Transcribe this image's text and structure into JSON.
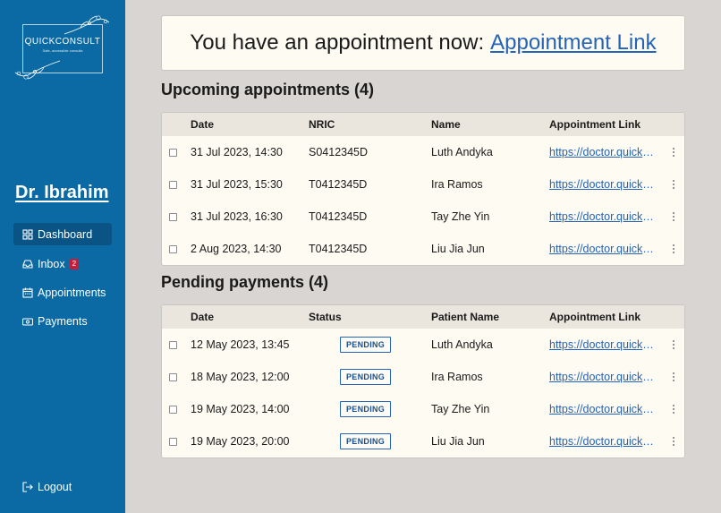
{
  "sidebar": {
    "logo": {
      "brand": "QUICKCONSULT",
      "tagline": "Safe, accessible consults"
    },
    "doctor_name": "Dr. Ibrahim",
    "nav": [
      {
        "label": "Dashboard",
        "icon": "dashboard-icon",
        "active": true
      },
      {
        "label": "Inbox",
        "icon": "inbox-icon",
        "badge": "2"
      },
      {
        "label": "Appointments",
        "icon": "calendar-icon"
      },
      {
        "label": "Payments",
        "icon": "payment-icon"
      }
    ],
    "logout": "Logout"
  },
  "banner": {
    "text": "You have an appointment now:",
    "link": "Appointment Link"
  },
  "upcoming": {
    "title": "Upcoming appointments (4)",
    "headers": [
      "Date",
      "NRIC",
      "Name",
      "Appointment Link"
    ],
    "rows": [
      {
        "date": "31 Jul 2023, 14:30",
        "nric": "S0412345D",
        "name": "Luth Andyka",
        "link": "https://doctor.quickconsult"
      },
      {
        "date": "31 Jul 2023, 15:30",
        "nric": "T0412345D",
        "name": "Ira Ramos",
        "link": "https://doctor.quickconsult"
      },
      {
        "date": "31 Jul 2023, 16:30",
        "nric": "T0412345D",
        "name": "Tay Zhe Yin",
        "link": "https://doctor.quickconsult"
      },
      {
        "date": "2 Aug 2023, 14:30",
        "nric": "T0412345D",
        "name": "Liu Jia Jun",
        "link": "https://doctor.quickconsult"
      }
    ]
  },
  "payments": {
    "title": "Pending payments (4)",
    "headers": [
      "Date",
      "Status",
      "Patient Name",
      "Appointment Link"
    ],
    "rows": [
      {
        "date": "12 May 2023, 13:45",
        "status": "PENDING",
        "name": "Luth Andyka",
        "link": "https://doctor.quickconsult"
      },
      {
        "date": "18 May 2023, 12:00",
        "status": "PENDING",
        "name": "Ira Ramos",
        "link": "https://doctor.quickconsult"
      },
      {
        "date": "19 May 2023, 14:00",
        "status": "PENDING",
        "name": "Tay Zhe Yin",
        "link": "https://doctor.quickconsult"
      },
      {
        "date": "19 May 2023, 20:00",
        "status": "PENDING",
        "name": "Liu Jia Jun",
        "link": "https://doctor.quickconsult"
      }
    ]
  },
  "colors": {
    "sidebar": "#0b69a3",
    "accent": "#2563b8",
    "badge": "#c41e3a",
    "background": "#d8d5d2"
  }
}
